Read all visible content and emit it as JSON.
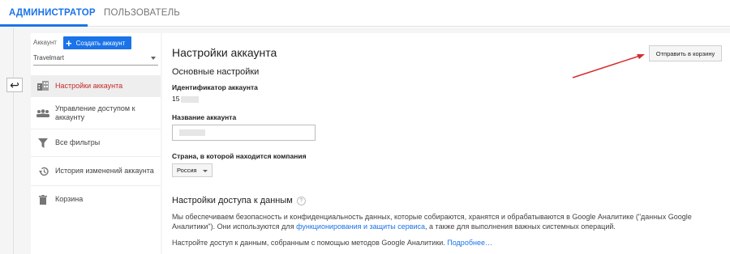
{
  "tabs": {
    "admin": "АДМИНИСТРАТОР",
    "user": "ПОЛЬЗОВАТЕЛЬ"
  },
  "sidebar": {
    "account_label": "Аккаунт",
    "create_button": "Создать аккаунт",
    "account_name": "Travelmart",
    "items": [
      {
        "label": "Настройки аккаунта",
        "icon": "building-icon"
      },
      {
        "label": "Управление доступом к аккаунту",
        "icon": "people-icon"
      },
      {
        "label": "Все фильтры",
        "icon": "filter-icon"
      },
      {
        "label": "История изменений аккаунта",
        "icon": "history-icon"
      },
      {
        "label": "Корзина",
        "icon": "trash-icon"
      }
    ]
  },
  "main": {
    "title": "Настройки аккаунта",
    "trash_button": "Отправить в корзину",
    "basic_section": "Основные настройки",
    "account_id_label": "Идентификатор аккаунта",
    "account_id_value": "15",
    "account_name_label": "Название аккаунта",
    "country_label": "Страна, в которой находится компания",
    "country_value": "Россия",
    "data_access_section": "Настройки доступа к данным",
    "para1_part1": "Мы обеспечиваем безопасность и конфиденциальность данных, которые собираются, хранятся и обрабатываются в Google Аналитике (\"данных Google Аналитики\"). Они используются для ",
    "para1_link": "функционирования и защиты сервиса",
    "para1_part2": ", а также для выполнения важных системных операций.",
    "para2_text": "Настройте доступ к данным, собранным с помощью методов Google Аналитики. ",
    "para2_link": "Подробнее…"
  },
  "colors": {
    "accent": "#1a73e8",
    "active_text": "#c62828",
    "annotation_arrow": "#d32f2f"
  }
}
